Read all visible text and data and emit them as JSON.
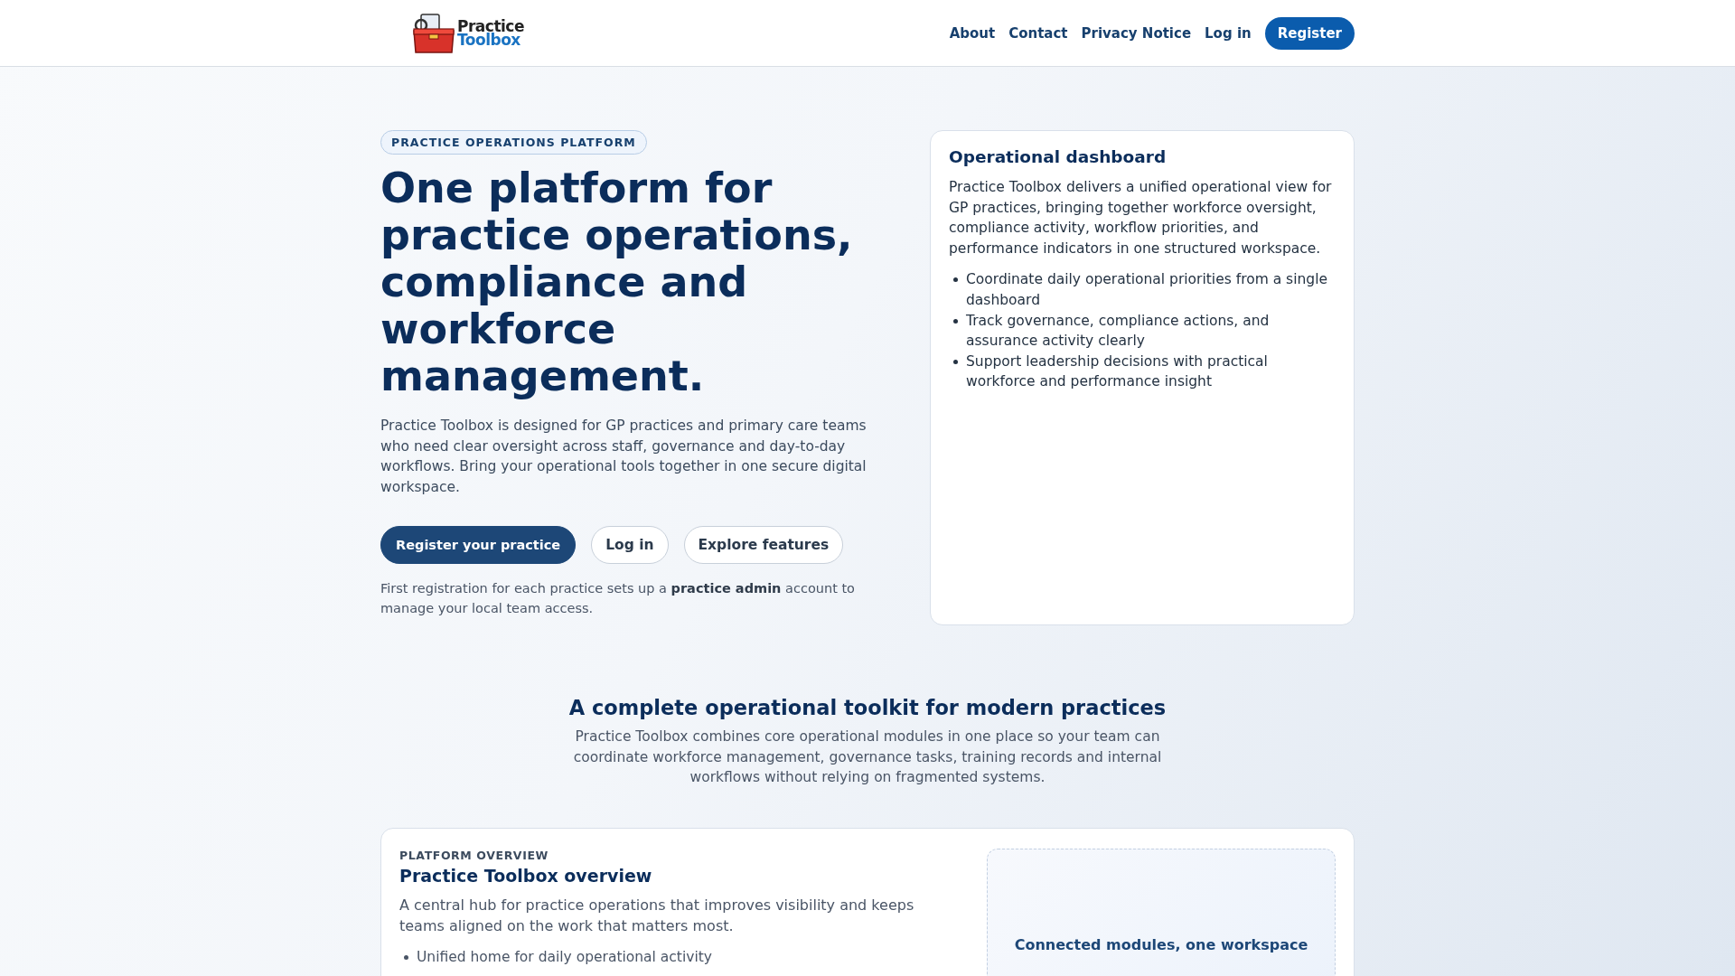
{
  "header": {
    "logo": {
      "line_1": "Practice",
      "line_2": "Toolbox"
    },
    "nav": [
      {
        "label": "About",
        "kind": "link"
      },
      {
        "label": "Contact",
        "kind": "link"
      },
      {
        "label": "Privacy Notice",
        "kind": "link"
      },
      {
        "label": "Log in",
        "kind": "link"
      },
      {
        "label": "Register",
        "kind": "button"
      }
    ]
  },
  "hero": {
    "eyebrow": "PRACTICE OPERATIONS PLATFORM",
    "title": "One platform for practice operations, compliance and workforce management.",
    "lead": "Practice Toolbox is designed for GP practices and primary care teams who need clear oversight across staff, governance and day-to-day workflows. Bring your operational tools together in one secure digital workspace.",
    "buttons": [
      {
        "label": "Register your practice",
        "kind": "primary"
      },
      {
        "label": "Log in",
        "kind": "outline"
      },
      {
        "label": "Explore features",
        "kind": "outline"
      }
    ],
    "note": "First registration for each practice sets up a **practice admin** account to manage your local team access."
  },
  "dashboard_card": {
    "title": "Operational dashboard",
    "text": "Practice Toolbox delivers a unified operational view for GP practices, bringing together workforce oversight, compliance activity, workflow priorities, and performance indicators in one structured workspace.",
    "items": [
      "Coordinate daily operational priorities from a single dashboard",
      "Track governance, compliance actions, and assurance activity clearly",
      "Support leadership decisions with practical workforce and performance insight"
    ]
  },
  "toolkit": {
    "title": "A complete operational toolkit for modern practices",
    "text": "Practice Toolbox combines core operational modules in one place so your team can coordinate workforce management, governance tasks, training records and internal workflows without relying on fragmented systems."
  },
  "overview": {
    "eyebrow": "PLATFORM OVERVIEW",
    "title": "Practice Toolbox overview",
    "text": "A central hub for practice operations that improves visibility and keeps teams aligned on the work that matters most.",
    "items": [
      "Unified home for daily operational activity"
    ],
    "panel_title": "Connected modules, one workspace"
  }
}
